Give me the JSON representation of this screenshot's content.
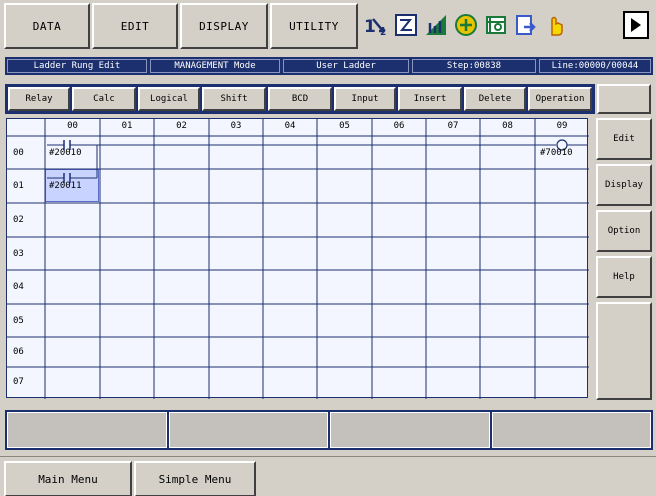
{
  "top_menu": {
    "data": "DATA",
    "edit": "EDIT",
    "display": "DISPLAY",
    "utility": "UTILITY"
  },
  "status_icons": [
    "number-switch-icon",
    "checkbox-icon",
    "signal-icon",
    "coordinate-icon",
    "tool-icon",
    "arrow-doc-icon",
    "hand-icon"
  ],
  "status": {
    "rung_mode": "Ladder Rung Edit",
    "security": "MANAGEMENT Mode",
    "ladder_type": "User Ladder",
    "step": "Step:00838",
    "line": "Line:00000/00044"
  },
  "toolbar": [
    "Relay",
    "Calc",
    "Logical",
    "Shift",
    "BCD",
    "Input",
    "Insert",
    "Delete",
    "Operation"
  ],
  "grid": {
    "columns": [
      "00",
      "01",
      "02",
      "03",
      "04",
      "05",
      "06",
      "07",
      "08",
      "09"
    ],
    "rows": [
      "00",
      "01",
      "02",
      "03",
      "04",
      "05",
      "06",
      "07"
    ],
    "contact_1": "#20010",
    "contact_2": "#20011",
    "coil": "#70010"
  },
  "side_menu": [
    "Edit",
    "Display",
    "Option",
    "Help"
  ],
  "bottom_menu": {
    "main": "Main Menu",
    "simple": "Simple Menu"
  },
  "colors": {
    "frame": "#1c2f6e",
    "panel": "#d4d0c8",
    "grid_bg": "#f4f6ff",
    "selected_cell": "#c8d4ff"
  }
}
